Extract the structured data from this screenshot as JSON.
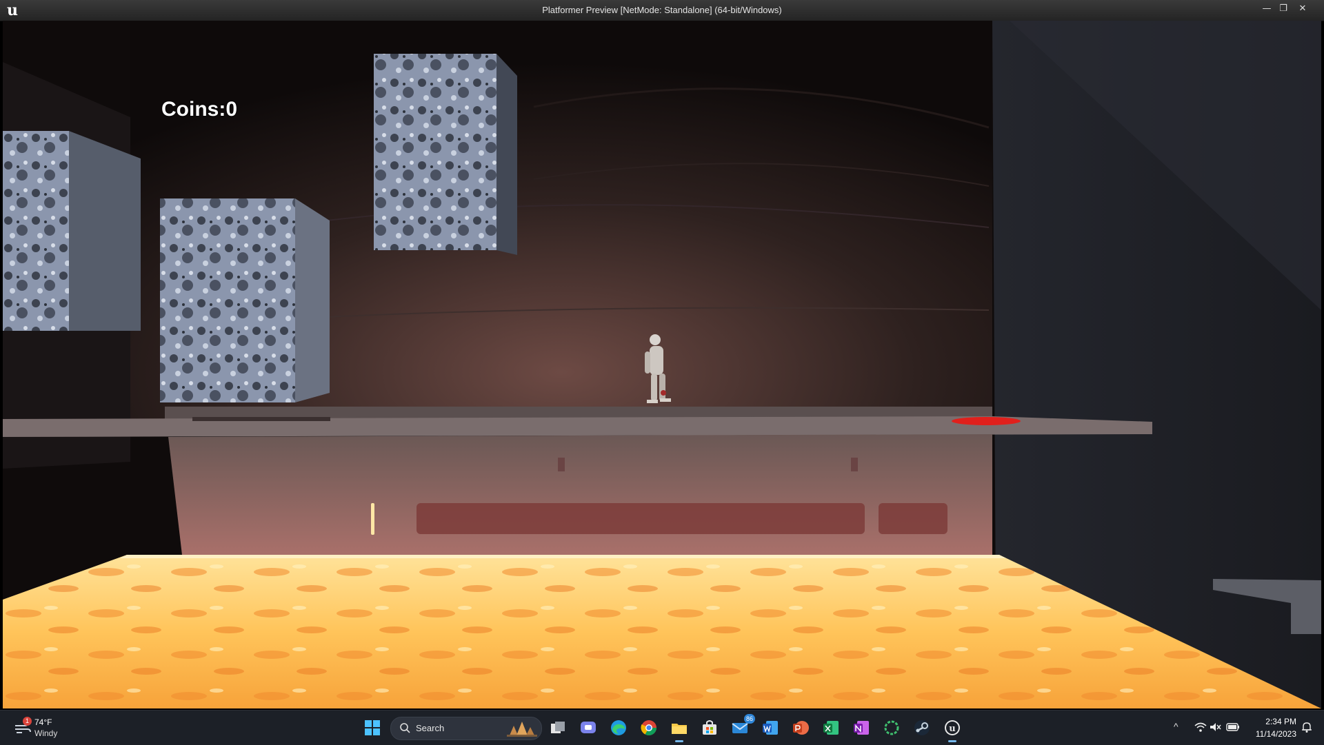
{
  "window": {
    "title": "Platformer Preview [NetMode: Standalone]  (64-bit/Windows)",
    "minimize": "—",
    "maximize": "❐",
    "close": "✕"
  },
  "hud": {
    "coins_text": "Coins:0"
  },
  "taskbar": {
    "weather": {
      "temp": "74°F",
      "desc": "Windy",
      "badge": "1"
    },
    "search": {
      "placeholder": "Search"
    },
    "apps": [
      {
        "name": "start-button"
      },
      {
        "name": "task-view-button"
      },
      {
        "name": "teams-chat-button"
      },
      {
        "name": "edge-browser-button"
      },
      {
        "name": "chrome-browser-button"
      },
      {
        "name": "file-explorer-button"
      },
      {
        "name": "microsoft-store-button"
      },
      {
        "name": "mail-button",
        "badge": "86"
      },
      {
        "name": "word-button"
      },
      {
        "name": "powerpoint-button"
      },
      {
        "name": "excel-button"
      },
      {
        "name": "onenote-button"
      },
      {
        "name": "loading-app-button"
      },
      {
        "name": "steam-button"
      },
      {
        "name": "unreal-engine-button"
      }
    ],
    "tray": {
      "chevron": "^"
    },
    "clock": {
      "time": "2:34 PM",
      "date": "11/14/2023"
    }
  }
}
